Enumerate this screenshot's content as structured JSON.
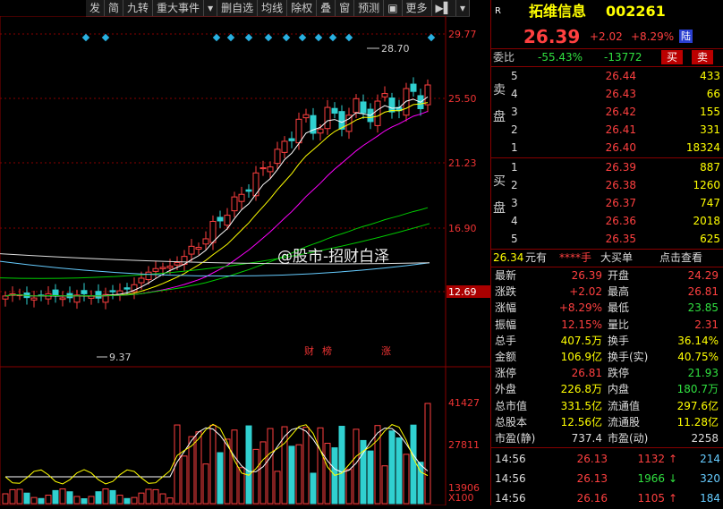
{
  "toolbar": [
    "发",
    "简",
    "九转",
    "重大事件",
    "▾",
    "删自选",
    "均线",
    "除权",
    "叠",
    "窗",
    "预测",
    "▣",
    "更多",
    "▶▌",
    "▾"
  ],
  "chart": {
    "y_labels": [
      "29.77",
      "25.50",
      "21.23",
      "16.90",
      "12.69"
    ],
    "vol_labels": [
      "41427",
      "27811",
      "13906",
      "X100"
    ],
    "high_label": "28.70",
    "low_label": "9.37",
    "event_markers": [
      "财",
      "榜",
      "涨"
    ]
  },
  "watermark": "@股市-招财白泽",
  "header": {
    "market": "R",
    "name": "拓维信息",
    "code": "002261",
    "price": "26.39",
    "change": "+2.02",
    "pct": "+8.29%",
    "exchange": "陆"
  },
  "weibi": {
    "label": "委比",
    "ratio": "-55.43%",
    "diff": "-13772",
    "buy": "买",
    "sell": "卖"
  },
  "sell_side": "卖盘",
  "buy_side": "买盘",
  "asks": [
    {
      "lvl": "5",
      "price": "26.44",
      "vol": "433"
    },
    {
      "lvl": "4",
      "price": "26.43",
      "vol": "66"
    },
    {
      "lvl": "3",
      "price": "26.42",
      "vol": "155"
    },
    {
      "lvl": "2",
      "price": "26.41",
      "vol": "331"
    },
    {
      "lvl": "1",
      "price": "26.40",
      "vol": "18324"
    }
  ],
  "bids": [
    {
      "lvl": "1",
      "price": "26.39",
      "vol": "887"
    },
    {
      "lvl": "2",
      "price": "26.38",
      "vol": "1260"
    },
    {
      "lvl": "3",
      "price": "26.37",
      "vol": "747"
    },
    {
      "lvl": "4",
      "price": "26.36",
      "vol": "2018"
    },
    {
      "lvl": "5",
      "price": "26.35",
      "vol": "625"
    }
  ],
  "bigorder": {
    "price": "26.34",
    "unit": "元有",
    "stars": "****手",
    "big": "大买单",
    "click": "点击查看"
  },
  "stats": [
    [
      "最新",
      "26.39",
      "开盘",
      "24.29"
    ],
    [
      "涨跌",
      "+2.02",
      "最高",
      "26.81"
    ],
    [
      "涨幅",
      "+8.29%",
      "最低",
      "23.85"
    ],
    [
      "振幅",
      "12.15%",
      "量比",
      "2.31"
    ],
    [
      "总手",
      "407.5万",
      "换手",
      "36.14%"
    ],
    [
      "金额",
      "106.9亿",
      "换手(实)",
      "40.75%"
    ],
    [
      "涨停",
      "26.81",
      "跌停",
      "21.93"
    ],
    [
      "外盘",
      "226.8万",
      "内盘",
      "180.7万"
    ],
    [
      "总市值",
      "331.5亿",
      "流通值",
      "297.6亿"
    ],
    [
      "总股本",
      "12.56亿",
      "流通股",
      "11.28亿"
    ],
    [
      "市盈(静)",
      "737.4",
      "市盈(动)",
      "2258"
    ]
  ],
  "ticks": [
    {
      "time": "14:56",
      "price": "26.13",
      "vol": "1132",
      "dir": "↑",
      "n": "214"
    },
    {
      "time": "14:56",
      "price": "26.13",
      "vol": "1966",
      "dir": "↓",
      "n": "320"
    },
    {
      "time": "14:56",
      "price": "26.16",
      "vol": "1105",
      "dir": "↑",
      "n": "184"
    }
  ]
}
